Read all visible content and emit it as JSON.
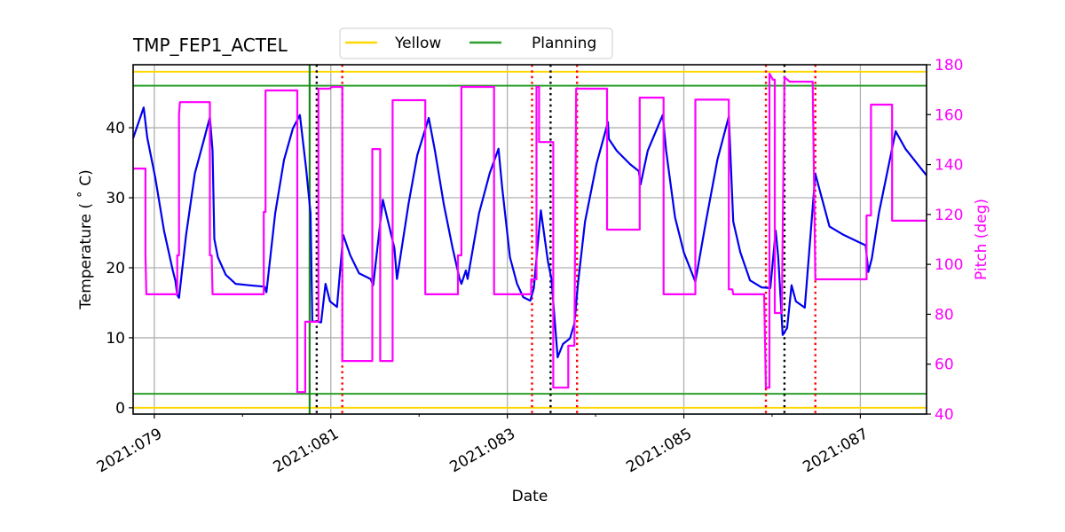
{
  "chart_data": {
    "type": "line",
    "title": "TMP_FEP1_ACTEL",
    "xlabel": "Date",
    "ylabel": "Temperature ($^\\circ$C)",
    "ylabel_display": "Temperature ( ˚ C)",
    "y2label": "Pitch (deg)",
    "xlim": [
      78.76,
      87.75
    ],
    "ylim": [
      -0.9,
      49
    ],
    "y2lim": [
      40,
      180
    ],
    "grid": true,
    "legend_placement": "top-center",
    "legend": [
      {
        "label": "Yellow",
        "color": "#ffd700"
      },
      {
        "label": "Planning",
        "color": "#2ca02c"
      }
    ],
    "xticks_major": [
      79,
      81,
      83,
      85,
      87
    ],
    "xticks_minor": [
      80,
      82,
      84,
      86
    ],
    "xtick_labels": [
      "2021:079",
      "2021:081",
      "2021:083",
      "2021:085",
      "2021:087"
    ],
    "yticks": [
      0,
      10,
      20,
      30,
      40
    ],
    "ytick_labels": [
      "0",
      "10",
      "20",
      "30",
      "40"
    ],
    "y2ticks": [
      40,
      60,
      80,
      100,
      120,
      140,
      160,
      180
    ],
    "y2tick_labels": [
      "40",
      "60",
      "80",
      "100",
      "120",
      "140",
      "160",
      "180"
    ],
    "colors": {
      "temperature": "#0000ee",
      "pitch": "#ff00ff",
      "yellow": "#ffd700",
      "planning": "#2ca02c",
      "grid": "#b0b0b0",
      "red_marker": "#ff0000",
      "black_marker": "#000000",
      "y2axis": "#ff00ff"
    },
    "limit_lines": [
      {
        "name": "yellow-high",
        "value": 48,
        "kind": "yellow"
      },
      {
        "name": "planning-high",
        "value": 46,
        "kind": "planning"
      },
      {
        "name": "planning-low",
        "value": 2,
        "kind": "planning"
      },
      {
        "name": "yellow-low",
        "value": 0,
        "kind": "yellow"
      }
    ],
    "vertical_lines": [
      {
        "x": 80.76,
        "kind": "planning-solid"
      },
      {
        "x": 80.84,
        "kind": "black-dotted"
      },
      {
        "x": 81.13,
        "kind": "red-dotted"
      },
      {
        "x": 83.28,
        "kind": "red-dotted"
      },
      {
        "x": 83.49,
        "kind": "black-dotted"
      },
      {
        "x": 83.79,
        "kind": "red-dotted"
      },
      {
        "x": 85.93,
        "kind": "red-dotted"
      },
      {
        "x": 86.14,
        "kind": "black-dotted"
      },
      {
        "x": 86.49,
        "kind": "red-dotted"
      }
    ],
    "series": [
      {
        "name": "TMP_FEP1_ACTEL",
        "axis": "left",
        "color": "#0000ee",
        "points": [
          [
            78.76,
            38.5
          ],
          [
            78.88,
            42.9
          ],
          [
            78.92,
            38.6
          ],
          [
            79.01,
            32.9
          ],
          [
            79.11,
            25.3
          ],
          [
            79.21,
            19.6
          ],
          [
            79.24,
            18.1
          ],
          [
            79.26,
            16.1
          ],
          [
            79.28,
            15.7
          ],
          [
            79.36,
            24.7
          ],
          [
            79.46,
            33.5
          ],
          [
            79.56,
            38.2
          ],
          [
            79.63,
            41.5
          ],
          [
            79.66,
            36.7
          ],
          [
            79.68,
            24.1
          ],
          [
            79.72,
            21.5
          ],
          [
            79.81,
            19.0
          ],
          [
            79.92,
            17.7
          ],
          [
            80.07,
            17.5
          ],
          [
            80.25,
            17.3
          ],
          [
            80.27,
            16.5
          ],
          [
            80.37,
            27.8
          ],
          [
            80.47,
            35.4
          ],
          [
            80.57,
            39.9
          ],
          [
            80.65,
            41.8
          ],
          [
            80.72,
            34.2
          ],
          [
            80.77,
            27.8
          ],
          [
            80.79,
            12.4
          ],
          [
            80.89,
            12.2
          ],
          [
            80.94,
            17.7
          ],
          [
            80.99,
            15.2
          ],
          [
            81.07,
            14.4
          ],
          [
            81.14,
            24.7
          ],
          [
            81.22,
            21.8
          ],
          [
            81.32,
            19.2
          ],
          [
            81.45,
            18.4
          ],
          [
            81.48,
            17.5
          ],
          [
            81.59,
            29.7
          ],
          [
            81.72,
            22.8
          ],
          [
            81.75,
            18.4
          ],
          [
            81.88,
            29.1
          ],
          [
            81.98,
            36.1
          ],
          [
            82.11,
            41.4
          ],
          [
            82.18,
            36.7
          ],
          [
            82.28,
            29.1
          ],
          [
            82.38,
            22.8
          ],
          [
            82.46,
            18.4
          ],
          [
            82.48,
            17.7
          ],
          [
            82.53,
            19.6
          ],
          [
            82.55,
            18.4
          ],
          [
            82.68,
            27.8
          ],
          [
            82.8,
            33.5
          ],
          [
            82.9,
            37.0
          ],
          [
            82.94,
            31.6
          ],
          [
            83.03,
            21.5
          ],
          [
            83.11,
            17.7
          ],
          [
            83.18,
            15.8
          ],
          [
            83.26,
            15.3
          ],
          [
            83.3,
            17.1
          ],
          [
            83.38,
            28.2
          ],
          [
            83.46,
            20.9
          ],
          [
            83.5,
            18.4
          ],
          [
            83.57,
            7.2
          ],
          [
            83.63,
            9.1
          ],
          [
            83.71,
            9.9
          ],
          [
            83.76,
            12.0
          ],
          [
            83.8,
            17.7
          ],
          [
            83.88,
            26.6
          ],
          [
            84.01,
            34.8
          ],
          [
            84.14,
            40.8
          ],
          [
            84.15,
            38.4
          ],
          [
            84.24,
            36.7
          ],
          [
            84.39,
            34.8
          ],
          [
            84.49,
            33.8
          ],
          [
            84.51,
            31.9
          ],
          [
            84.59,
            36.7
          ],
          [
            84.76,
            41.8
          ],
          [
            84.8,
            36.7
          ],
          [
            84.9,
            27.2
          ],
          [
            85.0,
            22.2
          ],
          [
            85.13,
            18.0
          ],
          [
            85.25,
            26.6
          ],
          [
            85.38,
            35.4
          ],
          [
            85.51,
            41.6
          ],
          [
            85.56,
            26.6
          ],
          [
            85.64,
            22.2
          ],
          [
            85.75,
            18.2
          ],
          [
            85.88,
            17.2
          ],
          [
            85.98,
            17.1
          ],
          [
            86.04,
            25.3
          ],
          [
            86.07,
            21.5
          ],
          [
            86.12,
            10.4
          ],
          [
            86.17,
            11.4
          ],
          [
            86.22,
            17.5
          ],
          [
            86.27,
            15.2
          ],
          [
            86.37,
            14.3
          ],
          [
            86.49,
            33.4
          ],
          [
            86.65,
            25.9
          ],
          [
            86.81,
            24.7
          ],
          [
            87.06,
            23.2
          ],
          [
            87.09,
            19.4
          ],
          [
            87.13,
            21.3
          ],
          [
            87.21,
            27.8
          ],
          [
            87.4,
            39.5
          ],
          [
            87.51,
            37.0
          ],
          [
            87.66,
            34.6
          ],
          [
            87.75,
            33.2
          ]
        ]
      },
      {
        "name": "Pitch",
        "axis": "right",
        "color": "#ff00ff",
        "step": true,
        "points": [
          [
            78.76,
            138.4
          ],
          [
            78.9,
            138.4
          ],
          [
            78.9,
            103.6
          ],
          [
            78.91,
            88
          ],
          [
            79.26,
            88
          ],
          [
            79.26,
            103.6
          ],
          [
            79.28,
            103.6
          ],
          [
            79.28,
            160
          ],
          [
            79.29,
            165
          ],
          [
            79.63,
            165
          ],
          [
            79.63,
            103.6
          ],
          [
            79.65,
            103.6
          ],
          [
            79.66,
            88
          ],
          [
            80.24,
            88
          ],
          [
            80.24,
            121
          ],
          [
            80.26,
            121
          ],
          [
            80.26,
            169.7
          ],
          [
            80.62,
            169.7
          ],
          [
            80.62,
            48.8
          ],
          [
            80.71,
            48.8
          ],
          [
            80.71,
            77
          ],
          [
            80.86,
            77
          ],
          [
            80.86,
            170.4
          ],
          [
            80.99,
            170.4
          ],
          [
            81.01,
            171.1
          ],
          [
            81.13,
            171.1
          ],
          [
            81.13,
            61.3
          ],
          [
            81.47,
            61.3
          ],
          [
            81.47,
            146.2
          ],
          [
            81.56,
            146.2
          ],
          [
            81.56,
            61.3
          ],
          [
            81.7,
            61.3
          ],
          [
            81.7,
            165.8
          ],
          [
            82.07,
            165.8
          ],
          [
            82.07,
            88
          ],
          [
            82.44,
            88
          ],
          [
            82.44,
            103.6
          ],
          [
            82.48,
            103.6
          ],
          [
            82.48,
            171.1
          ],
          [
            82.85,
            171.1
          ],
          [
            82.85,
            88
          ],
          [
            83.27,
            88
          ],
          [
            83.27,
            94
          ],
          [
            83.33,
            94
          ],
          [
            83.33,
            171.1
          ],
          [
            83.36,
            171.1
          ],
          [
            83.36,
            149
          ],
          [
            83.49,
            149
          ],
          [
            83.52,
            149
          ],
          [
            83.52,
            50.6
          ],
          [
            83.69,
            50.6
          ],
          [
            83.69,
            67.4
          ],
          [
            83.76,
            67.4
          ],
          [
            83.78,
            170.4
          ],
          [
            84.13,
            170.4
          ],
          [
            84.13,
            113.9
          ],
          [
            84.5,
            113.9
          ],
          [
            84.5,
            166.8
          ],
          [
            84.77,
            166.8
          ],
          [
            84.77,
            88
          ],
          [
            85.13,
            88
          ],
          [
            85.13,
            166.0
          ],
          [
            85.51,
            166.0
          ],
          [
            85.51,
            90
          ],
          [
            85.55,
            90
          ],
          [
            85.56,
            88
          ],
          [
            85.91,
            88
          ],
          [
            85.93,
            50.6
          ],
          [
            85.97,
            50.6
          ],
          [
            85.97,
            176.4
          ],
          [
            86.01,
            174.0
          ],
          [
            86.03,
            174
          ],
          [
            86.03,
            80.5
          ],
          [
            86.11,
            80.5
          ],
          [
            86.14,
            175.0
          ],
          [
            86.2,
            173.2
          ],
          [
            86.46,
            173.2
          ],
          [
            86.49,
            94
          ],
          [
            87.07,
            94
          ],
          [
            87.07,
            119.6
          ],
          [
            87.12,
            119.6
          ],
          [
            87.12,
            164
          ],
          [
            87.36,
            164
          ],
          [
            87.36,
            117.5
          ],
          [
            87.75,
            117.5
          ]
        ]
      }
    ]
  }
}
